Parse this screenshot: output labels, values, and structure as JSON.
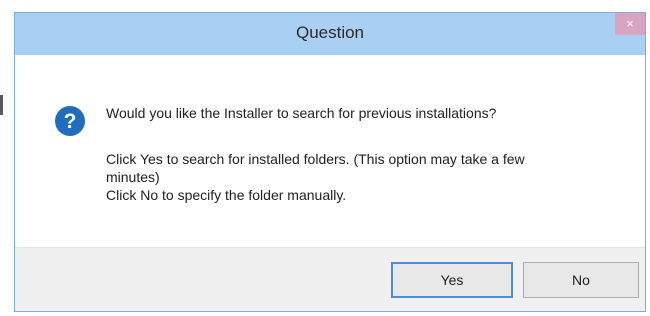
{
  "window": {
    "title": "Question",
    "close_glyph": "×"
  },
  "icon": {
    "name": "question-icon",
    "glyph": "?",
    "color": "#1f6dbf"
  },
  "message": {
    "line1": "Would you like the Installer to search for previous installations?",
    "line2": "Click Yes to search for installed folders. (This option may take a few",
    "line3": "minutes)",
    "line4": "Click No to specify the folder manually."
  },
  "buttons": {
    "yes": "Yes",
    "no": "No"
  },
  "colors": {
    "titlebar": "#a9d0f3",
    "close_button": "#d9a3c2",
    "footer": "#f0f0f0",
    "default_button_border": "#4a8fd4"
  }
}
